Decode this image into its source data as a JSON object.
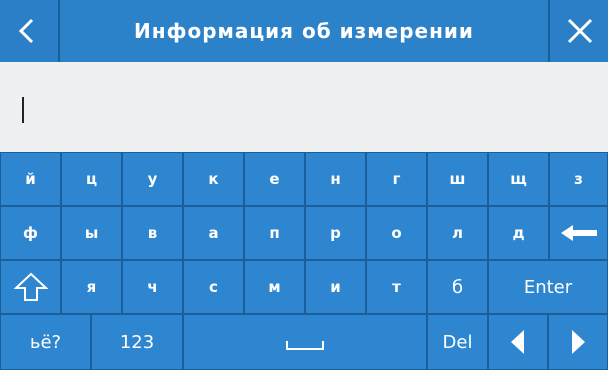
{
  "header": {
    "title": "Информация об измерении",
    "back_icon": "chevron-left-icon",
    "close_icon": "close-icon"
  },
  "input": {
    "value": ""
  },
  "keyboard": {
    "row1": [
      "й",
      "ц",
      "у",
      "к",
      "е",
      "н",
      "г",
      "ш",
      "щ",
      "з"
    ],
    "row2": [
      "ф",
      "ы",
      "в",
      "а",
      "п",
      "р",
      "о",
      "л",
      "д"
    ],
    "row3": [
      "я",
      "ч",
      "с",
      "м",
      "и",
      "т",
      "б"
    ],
    "enter_label": "Enter",
    "alt_label": "ьё?",
    "numbers_label": "123",
    "del_label": "Del",
    "backspace_icon": "backspace-arrow-icon",
    "shift_icon": "shift-icon",
    "space_icon": "space-icon",
    "left_icon": "left-arrow-icon",
    "right_icon": "right-arrow-icon"
  },
  "colors": {
    "accent": "#2c82c9",
    "key": "#2d86cf",
    "input_bg": "#eef0f2"
  }
}
